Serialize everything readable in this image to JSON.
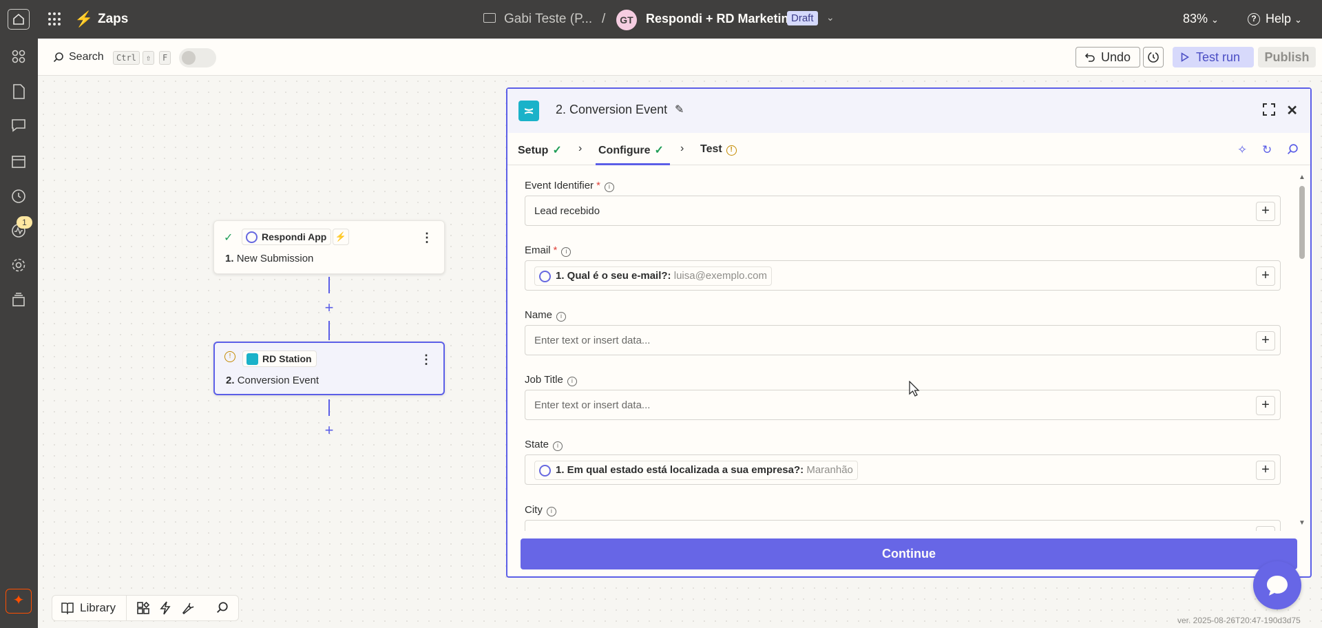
{
  "topbar": {
    "app_name": "Zaps",
    "folder": "Gabi Teste (P...",
    "separator": "/",
    "avatar_initials": "GT",
    "zap_name": "Respondi + RD Marketing",
    "status": "Draft",
    "zoom": "83%",
    "help": "Help"
  },
  "rail": {
    "notification_count": "1"
  },
  "toolbar": {
    "search": "Search",
    "shortcut_ctrl": "Ctrl",
    "shortcut_shift": "⇧",
    "shortcut_f": "F",
    "undo": "Undo",
    "test_run": "Test run",
    "publish": "Publish"
  },
  "canvas": {
    "steps": [
      {
        "app": "Respondi App",
        "number": "1.",
        "name": "New Submission"
      },
      {
        "app": "RD Station",
        "number": "2.",
        "name": "Conversion Event"
      }
    ]
  },
  "panel": {
    "title": "2. Conversion Event",
    "tabs": [
      {
        "label": "Setup"
      },
      {
        "label": "Configure"
      },
      {
        "label": "Test"
      }
    ],
    "fields": [
      {
        "label": "Event Identifier",
        "value": "Lead recebido"
      },
      {
        "label": "Email",
        "pill_label": "1. Qual é o seu e-mail?:",
        "pill_sample": "luisa@exemplo.com"
      },
      {
        "label": "Name",
        "placeholder": "Enter text or insert data..."
      },
      {
        "label": "Job Title",
        "placeholder": "Enter text or insert data..."
      },
      {
        "label": "State",
        "pill_label": "1. Em qual estado está localizada a sua empresa?:",
        "pill_sample": "Maranhão"
      },
      {
        "label": "City"
      }
    ],
    "continue": "Continue"
  },
  "bottombar": {
    "library": "Library"
  },
  "version": "ver. 2025-08-26T20:47-190d3d75",
  "colors": {
    "accent": "#5b5ee7",
    "brand": "#ff4f00",
    "topbar": "#403f3e",
    "success": "#1f9d57",
    "warning": "#c48a00"
  }
}
